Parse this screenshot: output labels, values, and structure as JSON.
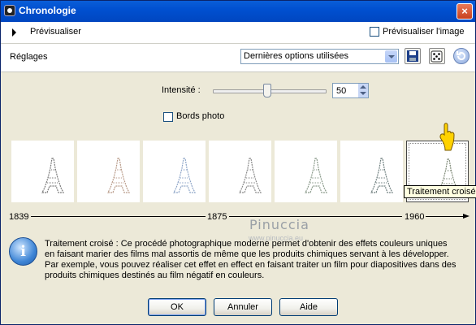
{
  "window": {
    "title": "Chronologie",
    "close_glyph": "×"
  },
  "preview": {
    "label": "Prévisualiser",
    "image_checkbox_label": "Prévisualiser l'image",
    "image_checked": false
  },
  "settings": {
    "label": "Réglages",
    "preset_value": "Dernières options utilisées"
  },
  "toolbar_icons": [
    "save-icon",
    "random-dice-icon",
    "reset-icon"
  ],
  "intensity": {
    "label": "Intensité :",
    "value": "50",
    "min": 0,
    "max": 100
  },
  "photo_edges": {
    "label": "Bords photo",
    "checked": false
  },
  "thumbnails": [
    {
      "name": "thumb-1",
      "tint": "#7a7a7a"
    },
    {
      "name": "thumb-2",
      "tint": "#b89a88"
    },
    {
      "name": "thumb-3",
      "tint": "#8fa6c8"
    },
    {
      "name": "thumb-4",
      "tint": "#8a8a8a"
    },
    {
      "name": "thumb-5",
      "tint": "#8a9a8a"
    },
    {
      "name": "thumb-6",
      "tint": "#6f7f7f"
    },
    {
      "name": "thumb-7",
      "tint": "#7f8a78",
      "selected": true
    }
  ],
  "tooltip": "Traitement croisé",
  "timeline": {
    "start": "1839",
    "mid": "1875",
    "end": "1960"
  },
  "watermark": {
    "name": "Pinuccia",
    "site": "www.pinuccia.eu"
  },
  "description": "Traitement croisé : Ce procédé photographique moderne permet d'obtenir des effets couleurs uniques en faisant marier des films mal assortis de même que les produits chimiques servant à les développer. Par exemple, vous pouvez réaliser cet effet en  effect en faisant traiter un film pour diapositives dans des produits chimiques destinés au film négatif en couleurs.",
  "buttons": {
    "ok": "OK",
    "cancel": "Annuler",
    "help": "Aide"
  },
  "colors": {
    "title_bar": "#0050d0",
    "dialog_bg": "#ece9d8",
    "tooltip_bg": "#ffffe1"
  }
}
